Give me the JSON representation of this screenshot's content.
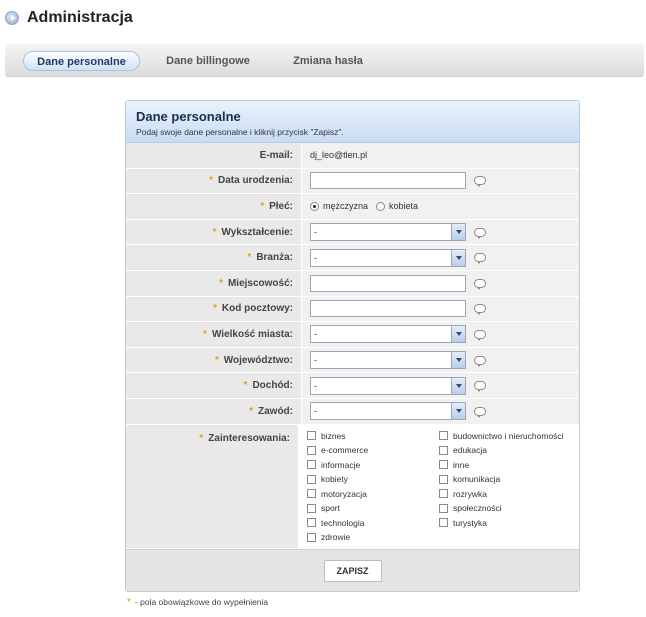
{
  "page": {
    "title": "Administracja"
  },
  "tabs": [
    {
      "label": "Dane personalne",
      "active": true
    },
    {
      "label": "Dane billingowe",
      "active": false
    },
    {
      "label": "Zmiana hasła",
      "active": false
    }
  ],
  "panel": {
    "title": "Dane personalne",
    "subtitle": "Podaj swoje dane personalne i kliknij przycisk \"Zapisz\"."
  },
  "form": {
    "email_label": "E-mail:",
    "email_value": "dj_leo@tlen.pl",
    "birth_label": "Data urodzenia:",
    "birth_value": "",
    "gender_label": "Płeć:",
    "gender_options": [
      "mężczyzna",
      "kobieta"
    ],
    "gender_selected": "mężczyzna",
    "education_label": "Wykształcenie:",
    "education_value": "-",
    "industry_label": "Branża:",
    "industry_value": "-",
    "city_label": "Miejscowość:",
    "city_value": "",
    "postal_label": "Kod pocztowy:",
    "postal_value": "",
    "city_size_label": "Wielkość miasta:",
    "city_size_value": "-",
    "province_label": "Województwo:",
    "province_value": "-",
    "income_label": "Dochód:",
    "income_value": "-",
    "profession_label": "Zawód:",
    "profession_value": "-",
    "interests_label": "Zainteresowania:",
    "interests_col1": [
      "biznes",
      "e-commerce",
      "informacje",
      "kobiety",
      "motoryzacja",
      "sport",
      "technologia",
      "zdrowie"
    ],
    "interests_col2": [
      "budownictwo i nieruchomości",
      "edukacja",
      "inne",
      "komunikacja",
      "rozrywka",
      "społeczności",
      "turystyka"
    ]
  },
  "actions": {
    "save_label": "ZAPISZ"
  },
  "legend": {
    "star": "*",
    "text": "- pola obowiązkowe do wypełnienia"
  },
  "colors": {
    "required_star": "#e0a020",
    "tab_active_border": "#a9c1e2",
    "panel_header": "#c9dcf3"
  }
}
